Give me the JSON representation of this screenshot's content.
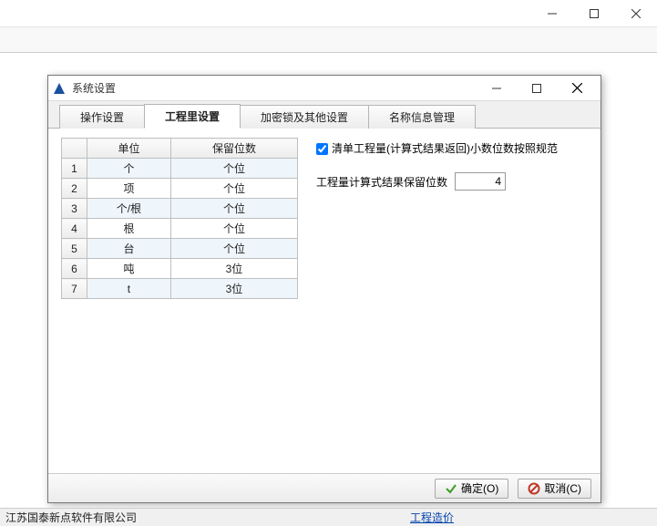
{
  "dialog": {
    "title": "系统设置",
    "tabs": [
      "操作设置",
      "工程里设置",
      "加密锁及其他设置",
      "名称信息管理"
    ],
    "active_tab_index": 1,
    "table": {
      "headers": [
        "",
        "单位",
        "保留位数"
      ],
      "rows": [
        {
          "n": "1",
          "unit": "个",
          "dec": "个位"
        },
        {
          "n": "2",
          "unit": "项",
          "dec": "个位"
        },
        {
          "n": "3",
          "unit": "个/根",
          "dec": "个位"
        },
        {
          "n": "4",
          "unit": "根",
          "dec": "个位"
        },
        {
          "n": "5",
          "unit": "台",
          "dec": "个位"
        },
        {
          "n": "6",
          "unit": "吨",
          "dec": "3位"
        },
        {
          "n": "7",
          "unit": "t",
          "dec": "3位"
        }
      ]
    },
    "checkbox": {
      "label": "清单工程量(计算式结果返回)小数位数按照规范",
      "checked": true
    },
    "decimal_field": {
      "label": "工程量计算式结果保留位数",
      "value": "4"
    },
    "buttons": {
      "ok": "确定(O)",
      "cancel": "取消(C)"
    }
  },
  "statusbar": {
    "company": "江苏国泰新点软件有限公司",
    "link": "工程造价"
  }
}
